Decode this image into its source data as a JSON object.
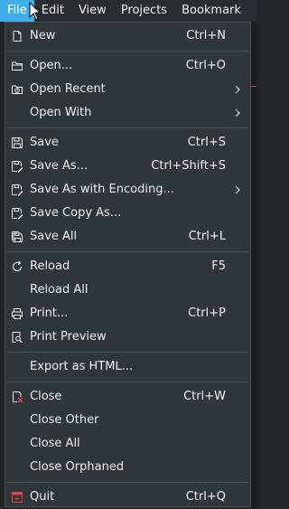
{
  "menubar": {
    "items": [
      {
        "label": "File"
      },
      {
        "label": "Edit"
      },
      {
        "label": "View"
      },
      {
        "label": "Projects"
      },
      {
        "label": "Bookmark"
      }
    ]
  },
  "file_menu": {
    "new": {
      "label": "New",
      "shortcut": "Ctrl+N",
      "icon": "new-document-icon"
    },
    "open": {
      "label": "Open...",
      "shortcut": "Ctrl+O",
      "icon": "folder-open-icon"
    },
    "open_recent": {
      "label": "Open Recent",
      "icon": "recent-icon"
    },
    "open_with": {
      "label": "Open With"
    },
    "save": {
      "label": "Save",
      "shortcut": "Ctrl+S",
      "icon": "save-icon"
    },
    "save_as": {
      "label": "Save As...",
      "shortcut": "Ctrl+Shift+S",
      "icon": "save-as-icon"
    },
    "save_as_encoding": {
      "label": "Save As with Encoding...",
      "icon": "save-as-icon"
    },
    "save_copy_as": {
      "label": "Save Copy As...",
      "icon": "save-as-icon"
    },
    "save_all": {
      "label": "Save All",
      "shortcut": "Ctrl+L",
      "icon": "save-all-icon"
    },
    "reload": {
      "label": "Reload",
      "shortcut": "F5",
      "icon": "reload-icon"
    },
    "reload_all": {
      "label": "Reload All"
    },
    "print": {
      "label": "Print...",
      "shortcut": "Ctrl+P",
      "icon": "printer-icon"
    },
    "print_preview": {
      "label": "Print Preview",
      "icon": "print-preview-icon"
    },
    "export_html": {
      "label": "Export as HTML..."
    },
    "close": {
      "label": "Close",
      "shortcut": "Ctrl+W",
      "icon": "close-document-icon"
    },
    "close_other": {
      "label": "Close Other"
    },
    "close_all": {
      "label": "Close All"
    },
    "close_orphaned": {
      "label": "Close Orphaned"
    },
    "quit": {
      "label": "Quit",
      "shortcut": "Ctrl+Q",
      "icon": "quit-icon"
    }
  },
  "colors": {
    "accent": "#3daee9",
    "menu_bg": "#31363b",
    "text": "#eff0f1",
    "danger": "#da4453"
  }
}
